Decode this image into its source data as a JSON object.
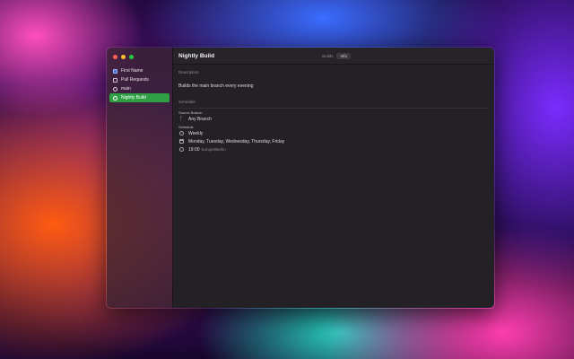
{
  "sidebar": {
    "items": [
      {
        "label": "First Name",
        "icon": "box-icon"
      },
      {
        "label": "Pull Requests",
        "icon": "pull-request-icon"
      },
      {
        "label": "main",
        "icon": "circle-icon"
      },
      {
        "label": "Nightly Build",
        "icon": "circle-icon",
        "selected": true
      }
    ]
  },
  "window": {
    "title": "Nightly Build",
    "tabs": [
      {
        "label": "Builds"
      },
      {
        "label": "Info",
        "active": true
      }
    ]
  },
  "info": {
    "description_label": "Description",
    "description": "Builds the main branch every evening",
    "schedule_label": "Schedule",
    "source_branch_label": "Source Branch",
    "source_branch": "Any Branch",
    "schedule_sub_label": "Schedule",
    "frequency": "Weekly",
    "days": "Monday, Tuesday, Wednesday, Thursday, Friday",
    "time": "19:00",
    "timezone": "Europe/Berlin"
  },
  "colors": {
    "selection": "#2ea043",
    "window_bg": "#232125"
  }
}
